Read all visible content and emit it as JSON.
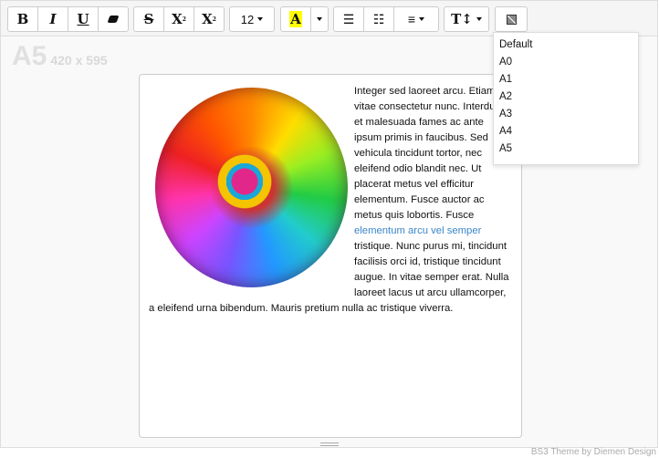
{
  "toolbar": {
    "bold": "B",
    "italic": "I",
    "underline": "U",
    "strike": "S",
    "superscript": "X",
    "sup_mark": "2",
    "subscript": "X",
    "sub_mark": "2",
    "font_size": "12",
    "highlight": "A",
    "highlight_color": "#ffff00",
    "line_height": "T↕"
  },
  "page_label": {
    "size": "A5",
    "dimensions": "420 x 595"
  },
  "content": {
    "text_before_link": "Integer sed laoreet arcu. Etiam vitae consectetur nunc. Interdum et malesuada fames ac ante ipsum primis in faucibus. Sed vehicula tincidunt tortor, nec eleifend odio blandit nec. Ut placerat metus vel efficitur elementum. Fusce auctor ac metus quis lobortis. Fusce ",
    "link": "elementum arcu vel semper",
    "text_after_link": " tristique. Nunc purus mi, tincidunt facilisis orci id, tristique tincidunt augue. In vitae semper erat. Nulla laoreet lacus ut arcu ullamcorper, a eleifend urna bibendum. Mauris pretium nulla ac tristique viverra.",
    "link_color": "#3a86c8"
  },
  "page_size_menu": {
    "items": [
      "Default",
      "A0",
      "A1",
      "A2",
      "A3",
      "A4",
      "A5"
    ]
  },
  "footer": "BS3 Theme by Diemen Design"
}
